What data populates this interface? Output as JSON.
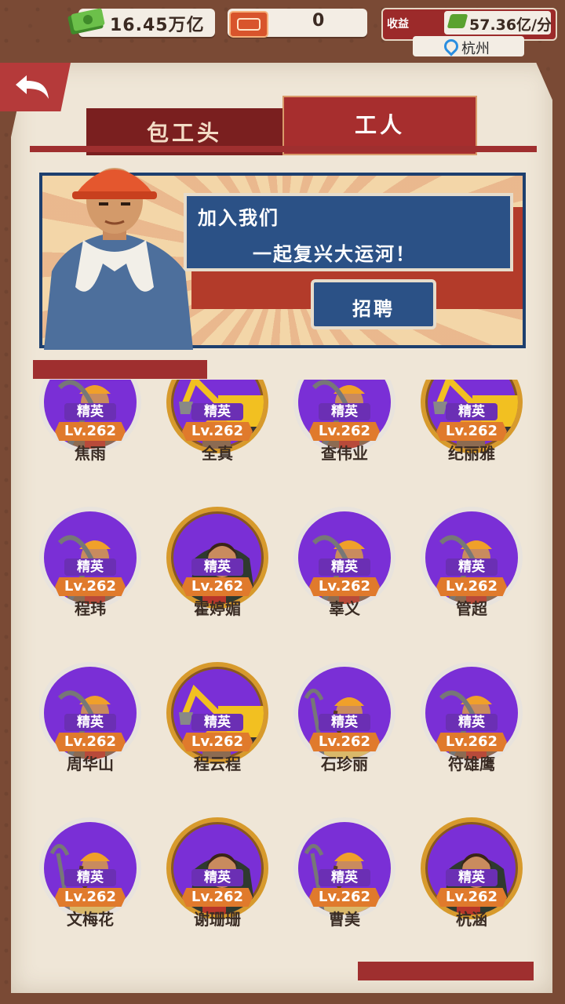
{
  "topbar": {
    "money": "16.45万亿",
    "tickets": "0",
    "income_label": "收益",
    "income_value": "57.36亿/分",
    "city": "杭州"
  },
  "tabs": [
    {
      "label": "包工头",
      "active": false
    },
    {
      "label": "工人",
      "active": true
    }
  ],
  "banner": {
    "line1": "加入我们",
    "line2": "一起复兴大运河！",
    "recruit_label": "招聘"
  },
  "colors": {
    "accent_red": "#9f2f2f",
    "avatar_purple": "#7a2fd6",
    "level_orange": "#e07a2c",
    "gold_frame": "#d79a2c"
  },
  "workers": [
    {
      "name": "焦雨",
      "rank": "精英",
      "level": "Lv.262",
      "frame": "silver",
      "type": "miner"
    },
    {
      "name": "全真",
      "rank": "精英",
      "level": "Lv.262",
      "frame": "gold",
      "type": "excavator"
    },
    {
      "name": "查伟业",
      "rank": "精英",
      "level": "Lv.262",
      "frame": "silver",
      "type": "miner"
    },
    {
      "name": "纪丽雅",
      "rank": "精英",
      "level": "Lv.262",
      "frame": "gold",
      "type": "excavator"
    },
    {
      "name": "程玮",
      "rank": "精英",
      "level": "Lv.262",
      "frame": "silver",
      "type": "miner"
    },
    {
      "name": "霍婷媚",
      "rank": "精英",
      "level": "Lv.262",
      "frame": "gold",
      "type": "demolition"
    },
    {
      "name": "辜义",
      "rank": "精英",
      "level": "Lv.262",
      "frame": "silver",
      "type": "miner"
    },
    {
      "name": "管超",
      "rank": "精英",
      "level": "Lv.262",
      "frame": "silver",
      "type": "miner"
    },
    {
      "name": "周华山",
      "rank": "精英",
      "level": "Lv.262",
      "frame": "silver",
      "type": "miner"
    },
    {
      "name": "程云程",
      "rank": "精英",
      "level": "Lv.262",
      "frame": "gold",
      "type": "excavator"
    },
    {
      "name": "石珍丽",
      "rank": "精英",
      "level": "Lv.262",
      "frame": "silver",
      "type": "woman-miner"
    },
    {
      "name": "符雄鹰",
      "rank": "精英",
      "level": "Lv.262",
      "frame": "silver",
      "type": "miner"
    },
    {
      "name": "文梅花",
      "rank": "精英",
      "level": "Lv.262",
      "frame": "silver",
      "type": "woman-miner"
    },
    {
      "name": "谢珊珊",
      "rank": "精英",
      "level": "Lv.262",
      "frame": "gold",
      "type": "demolition"
    },
    {
      "name": "曹美",
      "rank": "精英",
      "level": "Lv.262",
      "frame": "silver",
      "type": "woman-miner"
    },
    {
      "name": "杭涵",
      "rank": "精英",
      "level": "Lv.262",
      "frame": "gold",
      "type": "demolition"
    }
  ]
}
